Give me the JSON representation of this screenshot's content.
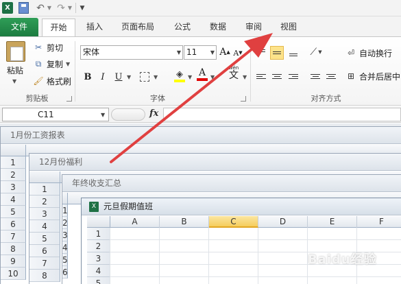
{
  "quick_access": {
    "app_icon": "X",
    "icons": [
      "excel-icon",
      "save-icon",
      "undo-icon",
      "redo-icon",
      "customize-icon"
    ]
  },
  "tabs": [
    {
      "label": "文件"
    },
    {
      "label": "开始"
    },
    {
      "label": "插入"
    },
    {
      "label": "页面布局"
    },
    {
      "label": "公式"
    },
    {
      "label": "数据"
    },
    {
      "label": "审阅"
    },
    {
      "label": "视图"
    }
  ],
  "ribbon": {
    "clipboard": {
      "paste": "粘贴",
      "cut": "剪切",
      "copy": "复制",
      "format_painter": "格式刷",
      "group_label": "剪贴板"
    },
    "font": {
      "font_name": "宋体",
      "font_size": "11",
      "bold": "B",
      "italic": "I",
      "underline": "U",
      "grow": "A",
      "shrink": "A",
      "font_color_letter": "A",
      "phonetic": "文",
      "phonetic_top": "wén",
      "group_label": "字体"
    },
    "alignment": {
      "wrap_text": "自动换行",
      "merge_center": "合并后居中",
      "group_label": "对齐方式"
    }
  },
  "formula_bar": {
    "name_box": "C11",
    "fx": "fx",
    "formula": ""
  },
  "windows": [
    {
      "title": "1月份工资报表"
    },
    {
      "title": "12月份福利"
    },
    {
      "title": "年终收支汇总"
    },
    {
      "title": "元旦假期值班"
    }
  ],
  "front_sheet": {
    "columns": [
      "A",
      "B",
      "C",
      "D",
      "E",
      "F"
    ],
    "selected_column": "C",
    "rows": [
      "1",
      "2",
      "3",
      "4",
      "5"
    ]
  },
  "sheet1_rows": [
    "1",
    "2",
    "3",
    "4",
    "5",
    "6",
    "7",
    "8",
    "9",
    "10"
  ],
  "sheet2_rows": [
    "1",
    "2",
    "3",
    "4",
    "5",
    "6",
    "7",
    "8"
  ],
  "sheet3_rows": [
    "1",
    "2",
    "3",
    "4",
    "5",
    "6"
  ],
  "watermark": "Baidu经验",
  "colors": {
    "file_tab": "#1b7a3f",
    "annotation_arrow": "#e04040",
    "selected_column": "#f5cd5d"
  }
}
